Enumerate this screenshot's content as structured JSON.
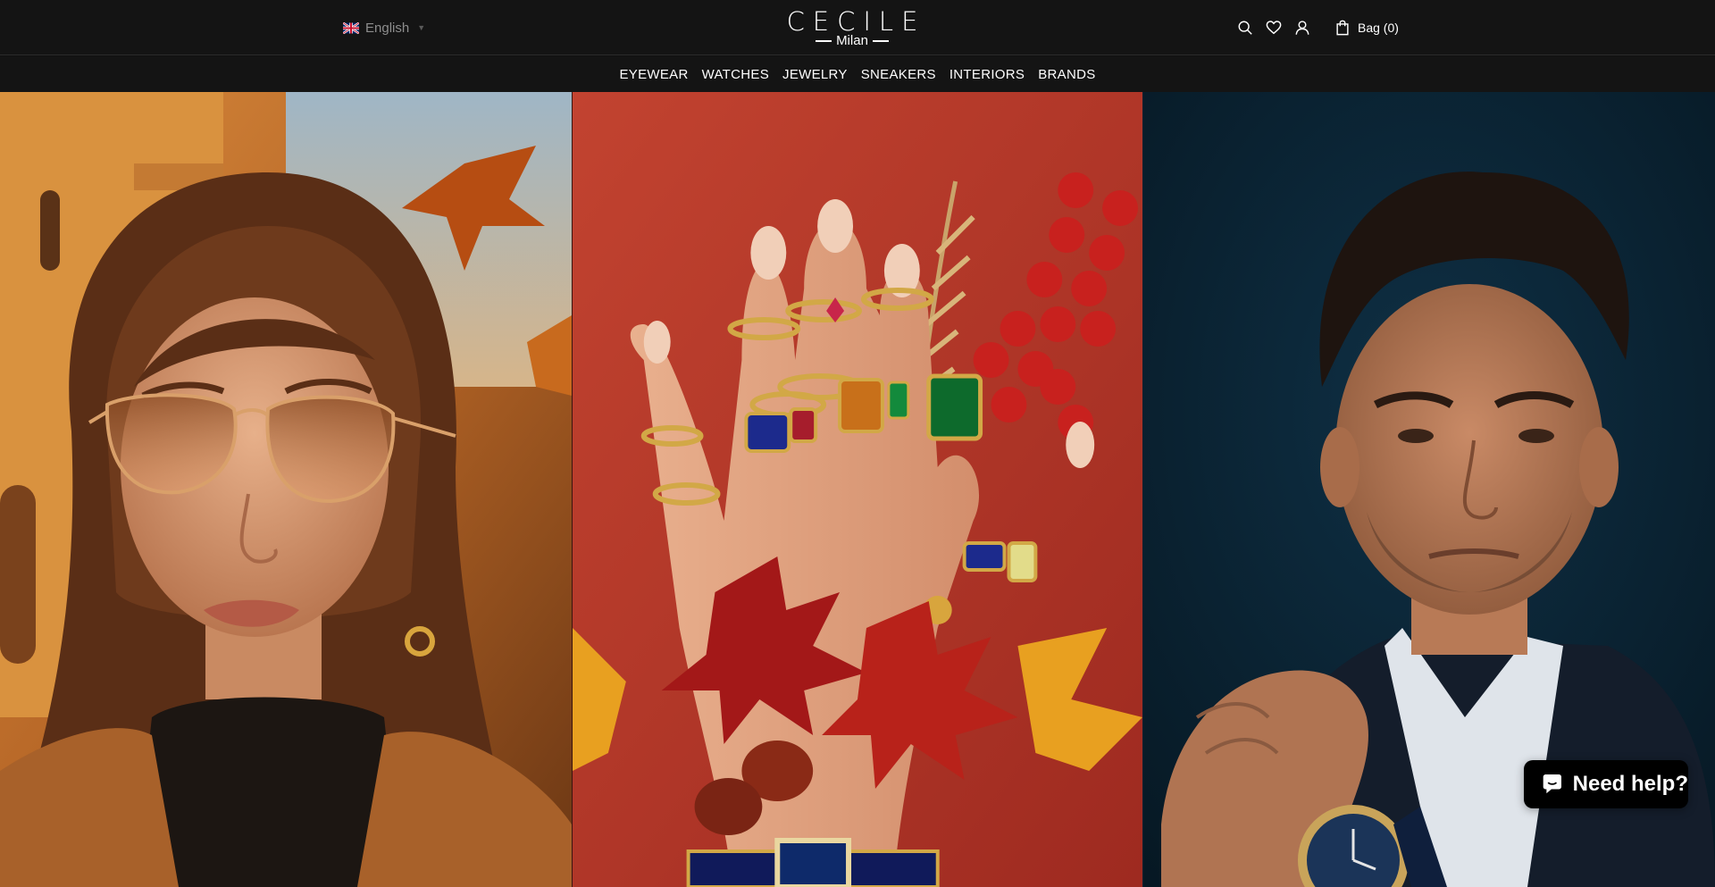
{
  "header": {
    "language": {
      "label": "English",
      "flag": "uk-flag-icon"
    },
    "logo": {
      "main": "CECILE",
      "sub": "Milan"
    },
    "icons": [
      "search-icon",
      "heart-icon",
      "user-icon",
      "bag-icon"
    ],
    "bag_label": "Bag (0)"
  },
  "nav": {
    "items": [
      {
        "label": "EYEWEAR"
      },
      {
        "label": "WATCHES"
      },
      {
        "label": "JEWELRY"
      },
      {
        "label": "SNEAKERS"
      },
      {
        "label": "INTERIORS"
      },
      {
        "label": "BRANDS"
      }
    ]
  },
  "hero": {
    "panels": [
      {
        "subject": "woman-with-sunglasses",
        "tone": "#c8762f"
      },
      {
        "subject": "hand-with-jeweled-rings",
        "tone": "#b8392a"
      },
      {
        "subject": "man-with-watch",
        "tone": "#0b2435"
      }
    ]
  },
  "chat": {
    "label": "Need help?",
    "icon": "chat-bubble-icon"
  },
  "colors": {
    "header_bg": "#141414",
    "text": "#ffffff",
    "muted": "#8d8d8d"
  }
}
